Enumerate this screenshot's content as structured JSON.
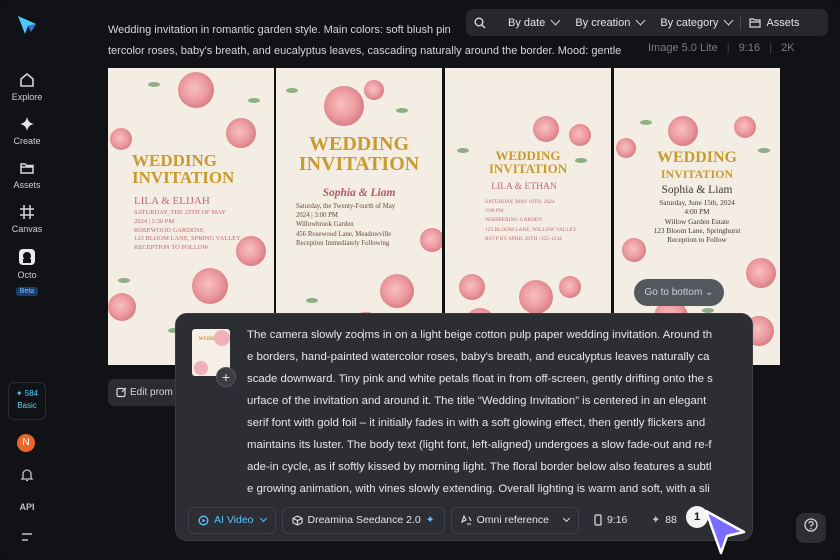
{
  "sidebar": {
    "items": [
      {
        "label": "Explore",
        "icon": "home-icon"
      },
      {
        "label": "Create",
        "icon": "sparkle-icon"
      },
      {
        "label": "Assets",
        "icon": "folder-icon"
      },
      {
        "label": "Canvas",
        "icon": "canvas-icon"
      },
      {
        "label": "Octo",
        "icon": "octo-icon",
        "badge": "Beta"
      }
    ],
    "credits": {
      "value": "584",
      "plan": "Basic"
    },
    "avatar": "N",
    "api": "API"
  },
  "toolbar": {
    "by_date": "By date",
    "by_creation": "By creation",
    "by_category": "By category",
    "assets": "Assets"
  },
  "generation": {
    "prompt": "Wedding invitation in romantic garden style. Main colors: soft blush pink, ivory, and sage green. Wa tercolor roses, baby's breath, and eucalyptus leaves, cascading naturally around the border. Mood: gentle,",
    "prompt_line1": "Wedding invitation in romantic garden style. Main colors: soft blush pin",
    "prompt_line2": "tercolor roses, baby's breath, and eucalyptus leaves, cascading naturally around the border. Mood: gentle",
    "model": "Image 5.0 Lite",
    "ratio": "9:16",
    "resolution": "2K"
  },
  "images": [
    {
      "title1": "WEDDING",
      "title2": "INVITATION",
      "names": "LILA & ELIJAH",
      "details": [
        "SATURDAY, THE 25TH OF MAY",
        "2024 | 2:30 PM",
        "ROSEWOOD GARDENS",
        "123 BLOOM LANE, SPRING VALLEY",
        "RECEPTION TO FOLLOW"
      ]
    },
    {
      "title1": "WEDDING",
      "title2": "INVITATION",
      "names": "Sophia & Liam",
      "details": [
        "Saturday, the Twenty-Fourth of May",
        "2024 | 3:00 PM",
        "Willowbrook Garden",
        "456 Rosewood Lane, Meadowville",
        "Reception Immediately Following"
      ]
    },
    {
      "title1": "WEDDING",
      "title2": "INVITATION",
      "names": "LILA & ETHAN",
      "details": [
        "SATURDAY, MAY 18TH, 2024",
        "3:00 PM",
        "WHISPERING GARDEN",
        "123 BLOOM LANE, WILLOW VALLEY",
        "RSVP BY APRIL 20TH | 555-1234"
      ]
    },
    {
      "title1": "WEDDING",
      "title2": "INVITATION",
      "names": "Sophia & Liam",
      "details": [
        "Saturday, June 15th, 2024",
        "4:00 PM",
        "Willow Garden Estate",
        "123 Bloom Lane, Springhurst",
        "Reception to Follow"
      ]
    }
  ],
  "go_to_bottom": "Go to bottom",
  "edit_prompt": "Edit prom",
  "composer": {
    "text": "The camera slowly zooms in on a light beige cotton pulp paper wedding invitation. Around the borders, hand-painted watercolor roses, baby's breath, and eucalyptus leaves naturally cascade downward. Tiny pink and white petals float in from off-screen, gently drifting onto the surface of the invitation and around it. The title “Wedding Invitation” is centered in an elegant serif font with gold foil – it initially fades in with a soft glowing effect, then gently flickers and maintains its luster. The body text (light font, left-aligned) undergoes a slow fade-out and re-fade-in cycle, as if softly kissed by morning light. The floral border below also features a subtle growing animation, with vines slowly extending. Overall lighting is warm and soft, with a slight breathing camera motion and a gentle spring breeze. The mood is gentle, sw",
    "text_before_cursor": "The camera slowly zoo",
    "text_after_cursor": "ms in on a light beige cotton pulp paper wedding invitation. Around the borders, hand-painted watercolor roses, baby's breath, and eucalyptus leaves naturally cascade downward. Tiny pink and white petals float in from off-screen, gently drifting onto the surface of the invitation and around it. The title “Wedding Invitation” is centered in an elegant serif font with gold foil – it initially fades in with a soft glowing effect, then gently flickers and maintains its luster. The body text (light font, left-aligned) undergoes a slow fade-out and re-fade-in cycle, as if softly kissed by morning light. The floral border below also features a subtle growing animation, with vines slowly extending. Overall lighting is warm and soft, with a slight breathing camera motion and a gentle spring breeze. The mood is gentle, sw",
    "mode": "AI Video",
    "model": "Dreamina Seedance 2.0",
    "reference": "Omni reference",
    "ratio": "9:16",
    "cost": "88",
    "count": "1"
  },
  "colors": {
    "accent": "#57d1ff",
    "background": "#111216",
    "panel": "#2c2e33",
    "gold": "#c99a2e"
  }
}
